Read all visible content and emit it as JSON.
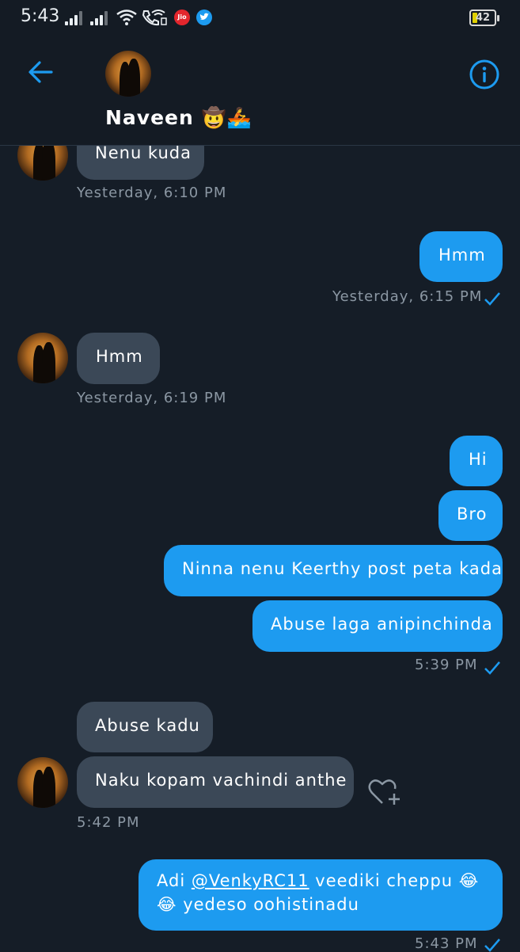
{
  "status_bar": {
    "time": "5:43",
    "battery": "42",
    "carrier_badge": "Jio"
  },
  "header": {
    "name": "Naveen",
    "emoji": "🤠🚣"
  },
  "messages": [
    {
      "side": "in",
      "text": "Nenu kuda",
      "time": "Yesterday, 6:10 PM"
    },
    {
      "side": "out",
      "text": "Hmm",
      "time": "Yesterday, 6:15 PM"
    },
    {
      "side": "in",
      "text": "Hmm",
      "time": "Yesterday, 6:19 PM"
    },
    {
      "side": "out",
      "text": "Hi"
    },
    {
      "side": "out",
      "text": "Bro"
    },
    {
      "side": "out",
      "text": "Ninna nenu Keerthy post peta kada"
    },
    {
      "side": "out",
      "text": "Abuse laga anipinchinda",
      "time": "5:39 PM"
    },
    {
      "side": "in",
      "text": "Abuse kadu"
    },
    {
      "side": "in",
      "text": "Naku kopam vachindi anthe",
      "time": "5:42 PM"
    },
    {
      "side": "out",
      "text_pre": "Adi ",
      "mention": "@VenkyRC11",
      "text_post": " veediki cheppu 😂",
      "text_line2": "😂 yedeso oohistinadu",
      "time": "5:43 PM"
    }
  ],
  "colors": {
    "background": "#151d27",
    "incoming": "#3b4857",
    "outgoing": "#1d9bf0",
    "accent": "#1d9bf0"
  }
}
